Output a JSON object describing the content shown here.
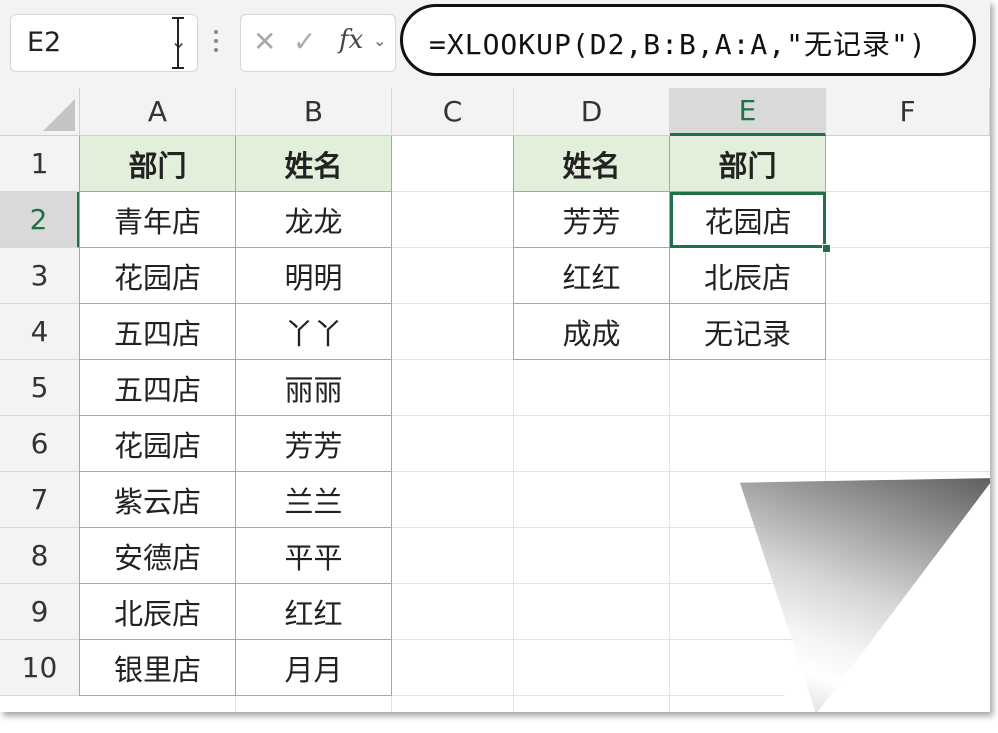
{
  "name_box": {
    "value": "E2"
  },
  "formula_bar": {
    "cancel": "✕",
    "confirm": "✓",
    "fx": "fx",
    "formula": "=XLOOKUP(D2,B:B,A:A,\"无记录\")"
  },
  "columns": [
    "A",
    "B",
    "C",
    "D",
    "E",
    "F"
  ],
  "rows": [
    "1",
    "2",
    "3",
    "4",
    "5",
    "6",
    "7",
    "8",
    "9",
    "10"
  ],
  "selected_cell": {
    "column": "E",
    "row": "2"
  },
  "table1": {
    "header": {
      "dept": "部门",
      "name": "姓名"
    },
    "rows": [
      {
        "dept": "青年店",
        "name": "龙龙"
      },
      {
        "dept": "花园店",
        "name": "明明"
      },
      {
        "dept": "五四店",
        "name": "丫丫"
      },
      {
        "dept": "五四店",
        "name": "丽丽"
      },
      {
        "dept": "花园店",
        "name": "芳芳"
      },
      {
        "dept": "紫云店",
        "name": "兰兰"
      },
      {
        "dept": "安德店",
        "name": "平平"
      },
      {
        "dept": "北辰店",
        "name": "红红"
      },
      {
        "dept": "银里店",
        "name": "月月"
      }
    ]
  },
  "table2": {
    "header": {
      "name": "姓名",
      "dept": "部门"
    },
    "rows": [
      {
        "name": "芳芳",
        "dept": "花园店"
      },
      {
        "name": "红红",
        "dept": "北辰店"
      },
      {
        "name": "成成",
        "dept": "无记录"
      }
    ]
  },
  "colors": {
    "header_fill": "#e2efda",
    "table_border": "#8ea9db",
    "selection": "#1e7145",
    "formula_outline": "#111111"
  }
}
